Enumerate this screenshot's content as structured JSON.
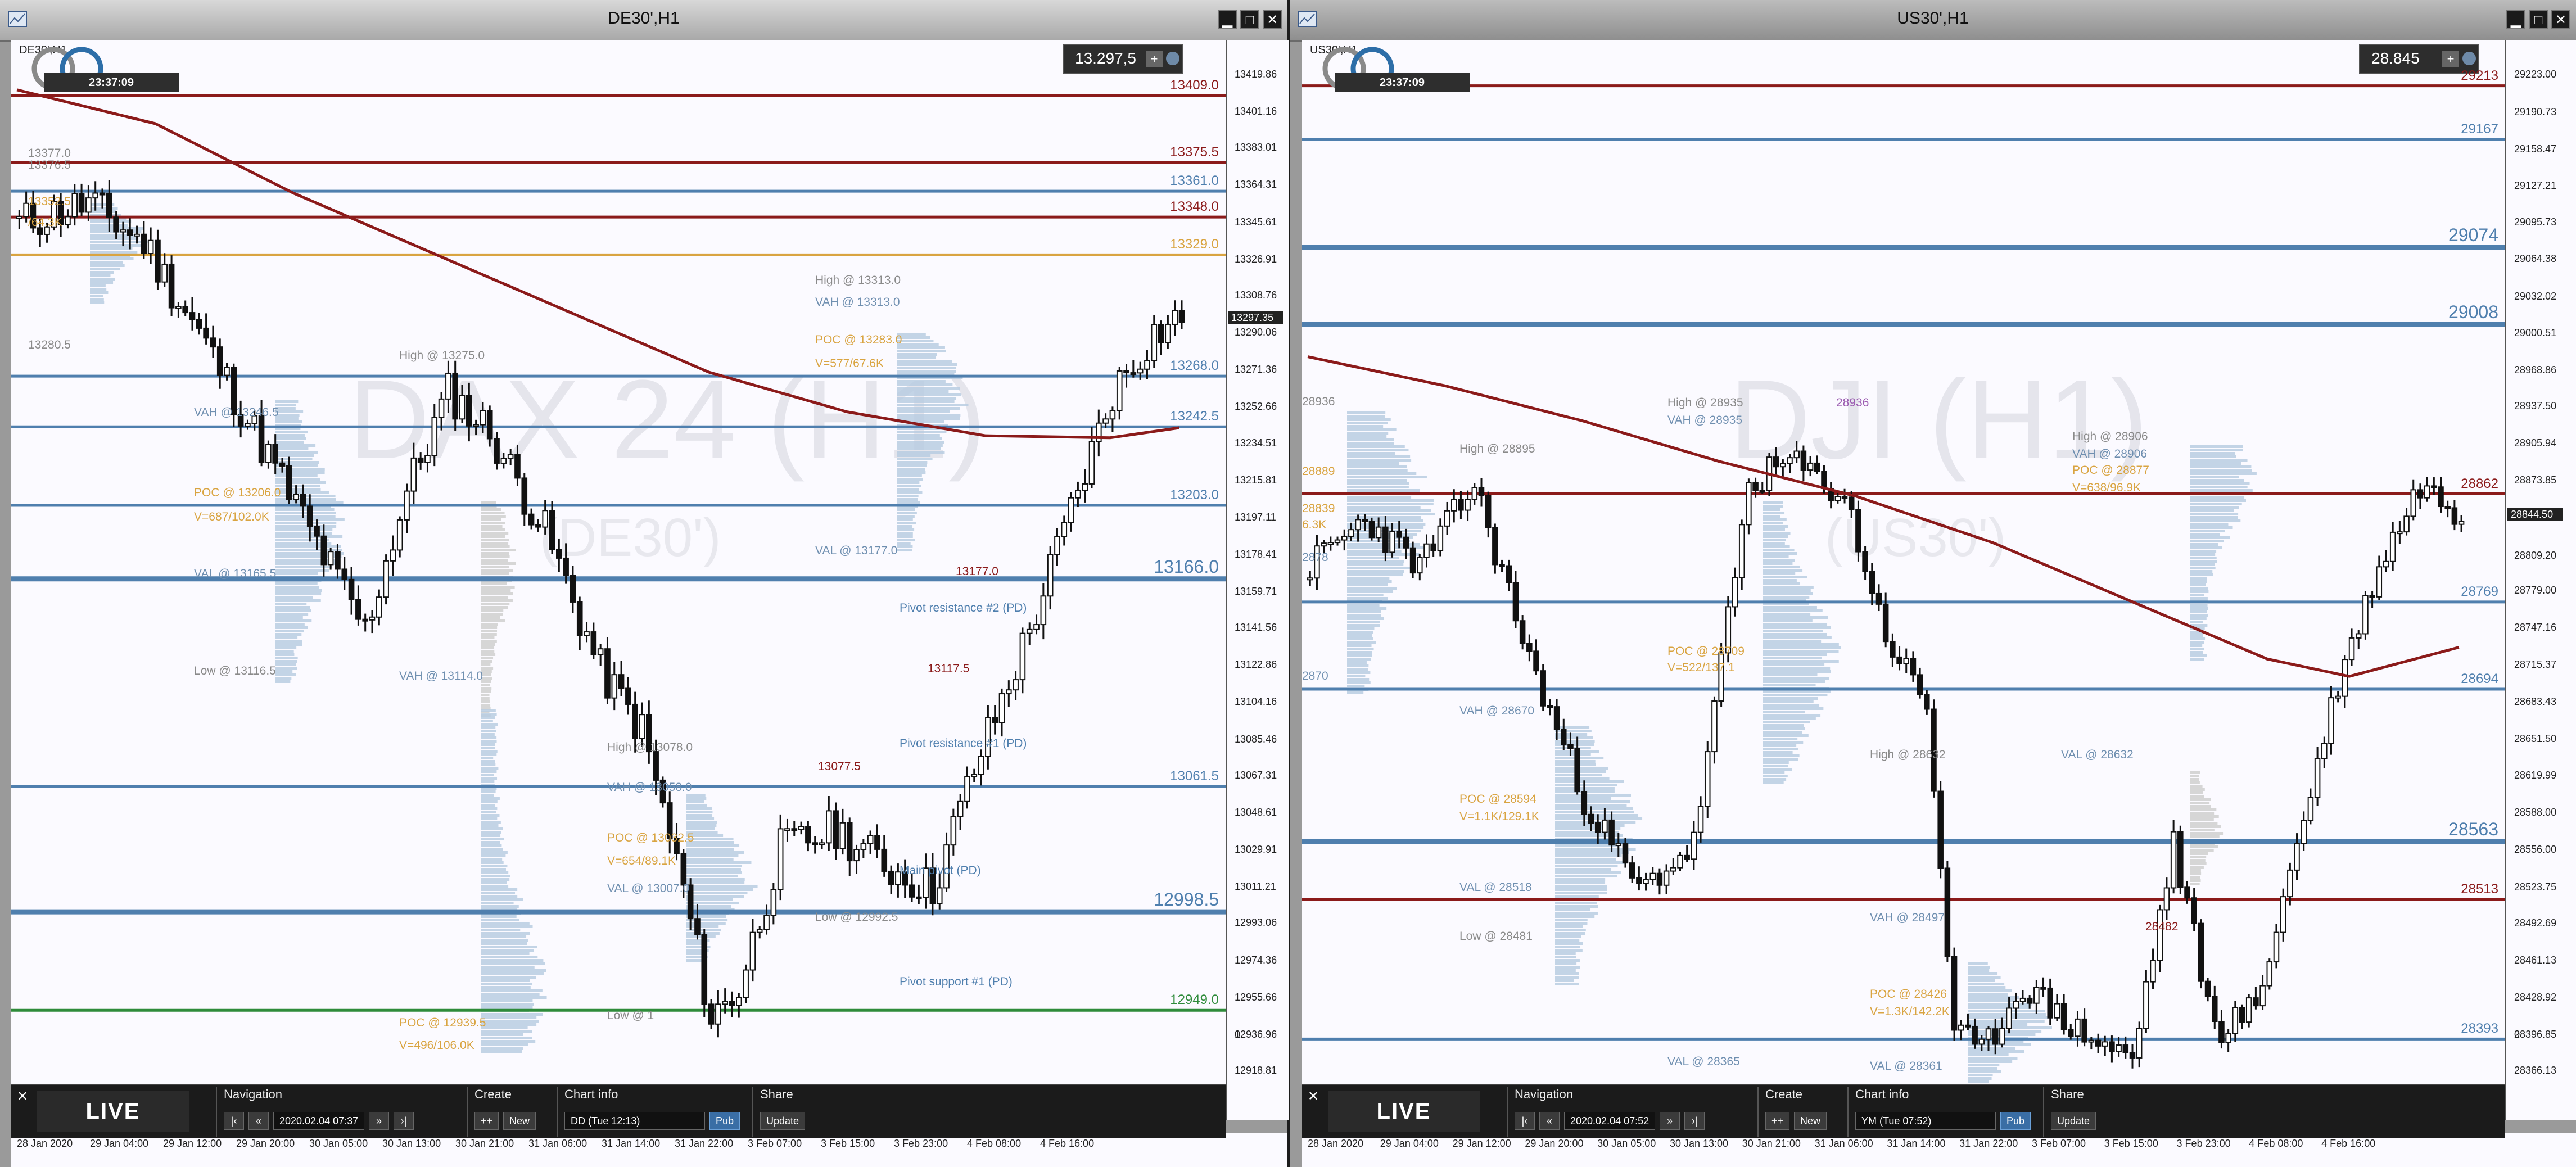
{
  "colors": {
    "bg": "#fbfaff",
    "bull": "#ffffff",
    "bear": "#111111",
    "maroon": "#8b1a1a",
    "steel": "#4f7fae",
    "gold": "#d9a441",
    "gray": "#a6a6a6",
    "profile": "#b9cde2",
    "green": "#2e8b3a"
  },
  "left": {
    "title": "DE30',H1",
    "symbol_label": "DE30',H1",
    "clock": "23:37:09",
    "price_box": "13.297,5",
    "watermark": "DAX 24 (H1)",
    "watermark_sub": "(DE30')",
    "yticks": [
      "13419.86",
      "13401.16",
      "13383.01",
      "13364.31",
      "13345.61",
      "13326.91",
      "13308.76",
      "13290.06",
      "13271.36",
      "13252.66",
      "13234.51",
      "13215.81",
      "13197.11",
      "13178.41",
      "13159.71",
      "13141.56",
      "13122.86",
      "13104.16",
      "13085.46",
      "13067.31",
      "13048.61",
      "13029.91",
      "13011.21",
      "12993.06",
      "12974.36",
      "12955.66",
      "12936.96",
      "12918.81",
      "0"
    ],
    "price_tag": "13297.35",
    "xticks": [
      "28 Jan 2020",
      "29 Jan 04:00",
      "29 Jan 12:00",
      "29 Jan 20:00",
      "30 Jan 05:00",
      "30 Jan 13:00",
      "30 Jan 21:00",
      "31 Jan 06:00",
      "31 Jan 14:00",
      "31 Jan 22:00",
      "3 Feb 07:00",
      "3 Feb 15:00",
      "3 Feb 23:00",
      "4 Feb 08:00",
      "4 Feb 16:00"
    ],
    "levels": [
      {
        "text": "13409.0",
        "price": 13409.0,
        "color": "#8b1a1a",
        "big": false
      },
      {
        "text": "13375.5",
        "price": 13375.5,
        "color": "#8b1a1a",
        "big": false
      },
      {
        "text": "13361.0",
        "price": 13361.0,
        "color": "#4f7fae",
        "big": false
      },
      {
        "text": "13348.0",
        "price": 13348.0,
        "color": "#8b1a1a",
        "big": false
      },
      {
        "text": "13329.0",
        "price": 13329.0,
        "color": "#d9a441",
        "big": false
      },
      {
        "text": "13268.0",
        "price": 13268.0,
        "color": "#4f7fae",
        "big": false
      },
      {
        "text": "13242.5",
        "price": 13242.5,
        "color": "#4f7fae",
        "big": false
      },
      {
        "text": "13203.0",
        "price": 13203.0,
        "color": "#4f7fae",
        "big": false
      },
      {
        "text": "13166.0",
        "price": 13166.0,
        "color": "#4f7fae",
        "big": true
      },
      {
        "text": "13061.5",
        "price": 13061.5,
        "color": "#4f7fae",
        "big": false
      },
      {
        "text": "12998.5",
        "price": 12998.5,
        "color": "#4f7fae",
        "big": true
      },
      {
        "text": "12949.0",
        "price": 12949.0,
        "color": "#2e8b3a",
        "big": false
      }
    ],
    "annotations": [
      {
        "text": "13377.0",
        "price": 13377.0,
        "x": 30,
        "color": "#8a8a8a"
      },
      {
        "text": "13376.5",
        "price": 13371.0,
        "x": 30,
        "color": "#8a8a8a"
      },
      {
        "text": "13352.5",
        "price": 13352.5,
        "x": 30,
        "color": "#d9a441"
      },
      {
        "text": "/64.3K",
        "price": 13342.0,
        "x": 30,
        "color": "#d9a441"
      },
      {
        "text": "13280.5",
        "price": 13280.5,
        "x": 30,
        "color": "#8a8a8a"
      },
      {
        "text": "High @ 13275.0",
        "price": 13275.0,
        "x": 690,
        "color": "#8a8a8a"
      },
      {
        "text": "High @ 13313.0",
        "price": 13313.0,
        "x": 1430,
        "color": "#8a8a8a"
      },
      {
        "text": "VAH @ 13313.0",
        "price": 13302.0,
        "x": 1430,
        "color": "#6f8fb0"
      },
      {
        "text": "POC @ 13283.0",
        "price": 13283.0,
        "x": 1430,
        "color": "#d9a441"
      },
      {
        "text": "V=577/67.6K",
        "price": 13271.0,
        "x": 1430,
        "color": "#d9a441"
      },
      {
        "text": "VAH @ 13246.5",
        "price": 13246.5,
        "x": 325,
        "color": "#6f8fb0"
      },
      {
        "text": "POC @ 13206.0",
        "price": 13206.0,
        "x": 325,
        "color": "#d9a441"
      },
      {
        "text": "V=687/102.0K",
        "price": 13194.0,
        "x": 325,
        "color": "#d9a441"
      },
      {
        "text": "VAL @ 13177.0",
        "price": 13177.0,
        "x": 1430,
        "color": "#6f8fb0"
      },
      {
        "text": "13177.0",
        "price": 13166.5,
        "x": 1680,
        "color": "#8b1a1a"
      },
      {
        "text": "VAL @ 13165.5",
        "price": 13165.5,
        "x": 325,
        "color": "#6f8fb0"
      },
      {
        "text": "Pivot resistance #2 (PD)",
        "price": 13148.0,
        "x": 1580,
        "color": "#4f7fae"
      },
      {
        "text": "Low @ 13116.5",
        "price": 13116.5,
        "x": 325,
        "color": "#8a8a8a"
      },
      {
        "text": "VAH @ 13114.0",
        "price": 13114.0,
        "x": 690,
        "color": "#6f8fb0"
      },
      {
        "text": "13117.5",
        "price": 13117.5,
        "x": 1630,
        "color": "#8b1a1a"
      },
      {
        "text": "High @ 13078.0",
        "price": 13078.0,
        "x": 1060,
        "color": "#8a8a8a"
      },
      {
        "text": "Pivot resistance #1 (PD)",
        "price": 13080.0,
        "x": 1580,
        "color": "#4f7fae"
      },
      {
        "text": "13077.5",
        "price": 13068.5,
        "x": 1435,
        "color": "#8b1a1a"
      },
      {
        "text": "VAH @ 13058.0",
        "price": 13058.0,
        "x": 1060,
        "color": "#6f8fb0"
      },
      {
        "text": "POC @ 13032.5",
        "price": 13032.5,
        "x": 1060,
        "color": "#d9a441"
      },
      {
        "text": "V=654/89.1K",
        "price": 13021.0,
        "x": 1060,
        "color": "#d9a441"
      },
      {
        "text": "Main pivot (PD)",
        "price": 13016.0,
        "x": 1580,
        "color": "#4f7fae"
      },
      {
        "text": "VAL @ 13007.0",
        "price": 13007.0,
        "x": 1060,
        "color": "#6f8fb0"
      },
      {
        "text": "Low @ 12992.5",
        "price": 12992.5,
        "x": 1430,
        "color": "#8a8a8a"
      },
      {
        "text": "Pivot support #1 (PD)",
        "price": 12960.0,
        "x": 1580,
        "color": "#4f7fae"
      },
      {
        "text": "POC @ 12939.5",
        "price": 12939.5,
        "x": 690,
        "color": "#d9a441"
      },
      {
        "text": "V=496/106.0K",
        "price": 12928.0,
        "x": 690,
        "color": "#d9a441"
      },
      {
        "text": "Low @ 1",
        "price": 12943.0,
        "x": 1060,
        "color": "#8a8a8a"
      }
    ],
    "nav": {
      "navigation": "Navigation",
      "datetime": "2020.02.04 07:37",
      "create": "Create",
      "new_label": "New",
      "chart_info": "Chart info",
      "instrument": "DD (Tue 12:13)",
      "pub": "Pub",
      "share": "Share",
      "update": "Update",
      "live": "LIVE"
    }
  },
  "right": {
    "title": "US30',H1",
    "symbol_label": "US30',H1",
    "clock": "23:37:09",
    "price_box": "28.845",
    "watermark": "DJI (H1)",
    "watermark_sub": "(US30')",
    "yticks": [
      "29223.00",
      "29190.73",
      "29158.47",
      "29127.21",
      "29095.73",
      "29064.38",
      "29032.02",
      "29000.51",
      "28968.86",
      "28937.50",
      "28905.94",
      "28873.85",
      "28841.78",
      "28809.20",
      "28779.00",
      "28747.16",
      "28715.37",
      "28683.43",
      "28651.50",
      "28619.99",
      "28588.00",
      "28556.00",
      "28523.75",
      "28492.69",
      "28461.13",
      "28428.92",
      "28396.85",
      "28366.13",
      "0"
    ],
    "price_tag": "28844.50",
    "xticks": [
      "28 Jan 2020",
      "29 Jan 04:00",
      "29 Jan 12:00",
      "29 Jan 20:00",
      "30 Jan 05:00",
      "30 Jan 13:00",
      "30 Jan 21:00",
      "31 Jan 06:00",
      "31 Jan 14:00",
      "31 Jan 22:00",
      "3 Feb 07:00",
      "3 Feb 15:00",
      "3 Feb 23:00",
      "4 Feb 08:00",
      "4 Feb 16:00"
    ],
    "levels": [
      {
        "text": "29213",
        "price": 29213,
        "color": "#8b1a1a",
        "big": false
      },
      {
        "text": "29167",
        "price": 29167,
        "color": "#4f7fae",
        "big": false
      },
      {
        "text": "29074",
        "price": 29074,
        "color": "#4f7fae",
        "big": true
      },
      {
        "text": "29008",
        "price": 29008,
        "color": "#4f7fae",
        "big": true
      },
      {
        "text": "28862",
        "price": 28862,
        "color": "#8b1a1a",
        "big": false
      },
      {
        "text": "28769",
        "price": 28769,
        "color": "#4f7fae",
        "big": false
      },
      {
        "text": "28694",
        "price": 28694,
        "color": "#4f7fae",
        "big": false
      },
      {
        "text": "28563",
        "price": 28563,
        "color": "#4f7fae",
        "big": true
      },
      {
        "text": "28513",
        "price": 28513,
        "color": "#8b1a1a",
        "big": false
      },
      {
        "text": "28393",
        "price": 28393,
        "color": "#4f7fae",
        "big": false
      }
    ],
    "annotations": [
      {
        "text": "28936",
        "price": 28936,
        "x": 0,
        "color": "#8a8a8a"
      },
      {
        "text": "High @ 28935",
        "price": 28935,
        "x": 650,
        "color": "#8a8a8a"
      },
      {
        "text": "28936",
        "price": 28935,
        "x": 950,
        "color": "#9a5ab0"
      },
      {
        "text": "VAH @ 28935",
        "price": 28920,
        "x": 650,
        "color": "#6f8fb0"
      },
      {
        "text": "High @ 28895",
        "price": 28895,
        "x": 280,
        "color": "#8a8a8a"
      },
      {
        "text": "28889",
        "price": 28876,
        "x": 0,
        "color": "#d9a441"
      },
      {
        "text": "28839",
        "price": 28844,
        "x": 0,
        "color": "#d9a441"
      },
      {
        "text": "6.3K",
        "price": 28830,
        "x": 0,
        "color": "#d9a441"
      },
      {
        "text": "2878",
        "price": 28802,
        "x": 0,
        "color": "#6f8fb0"
      },
      {
        "text": "High @ 28906",
        "price": 28906,
        "x": 1370,
        "color": "#8a8a8a"
      },
      {
        "text": "VAH @ 28906",
        "price": 28891,
        "x": 1370,
        "color": "#6f8fb0"
      },
      {
        "text": "POC @ 28877",
        "price": 28877,
        "x": 1370,
        "color": "#d9a441"
      },
      {
        "text": "V=638/96.9K",
        "price": 28862,
        "x": 1370,
        "color": "#d9a441"
      },
      {
        "text": "POC @ 28709",
        "price": 28721,
        "x": 650,
        "color": "#d9a441"
      },
      {
        "text": "V=522/137.1",
        "price": 28707,
        "x": 650,
        "color": "#d9a441"
      },
      {
        "text": "2870",
        "price": 28700,
        "x": 0,
        "color": "#6f8fb0"
      },
      {
        "text": "VAH @ 28670",
        "price": 28670,
        "x": 280,
        "color": "#6f8fb0"
      },
      {
        "text": "High @ 28632",
        "price": 28632,
        "x": 1010,
        "color": "#8a8a8a"
      },
      {
        "text": "VAL @ 28632",
        "price": 28632,
        "x": 1350,
        "color": "#6f8fb0"
      },
      {
        "text": "POC @ 28594",
        "price": 28594,
        "x": 280,
        "color": "#d9a441"
      },
      {
        "text": "V=1.1K/129.1K",
        "price": 28579,
        "x": 280,
        "color": "#d9a441"
      },
      {
        "text": "VAL @ 28518",
        "price": 28518,
        "x": 280,
        "color": "#6f8fb0"
      },
      {
        "text": "VAH @ 28497",
        "price": 28492,
        "x": 1010,
        "color": "#6f8fb0"
      },
      {
        "text": "28482",
        "price": 28484,
        "x": 1500,
        "color": "#8b1a1a"
      },
      {
        "text": "Low @ 28481",
        "price": 28476,
        "x": 280,
        "color": "#8a8a8a"
      },
      {
        "text": "POC @ 28426",
        "price": 28426,
        "x": 1010,
        "color": "#d9a441"
      },
      {
        "text": "V=1.3K/142.2K",
        "price": 28411,
        "x": 1010,
        "color": "#d9a441"
      },
      {
        "text": "VAL @ 28365",
        "price": 28368,
        "x": 650,
        "color": "#6f8fb0"
      },
      {
        "text": "VAL @ 28361",
        "price": 28364,
        "x": 1010,
        "color": "#6f8fb0"
      }
    ],
    "nav": {
      "navigation": "Navigation",
      "datetime": "2020.02.04 07:52",
      "create": "Create",
      "new_label": "New",
      "chart_info": "Chart info",
      "instrument": "YM (Tue 07:52)",
      "pub": "Pub",
      "share": "Share",
      "update": "Update",
      "live": "LIVE"
    }
  }
}
